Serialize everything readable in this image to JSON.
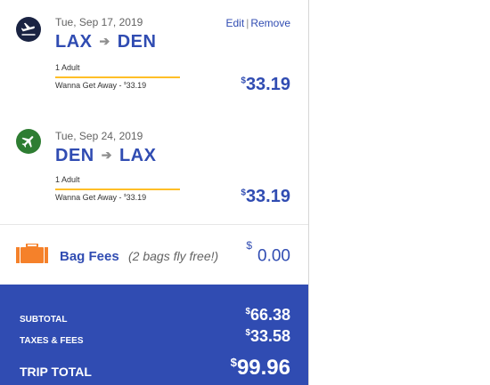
{
  "colors": {
    "brand_blue": "#304cb2",
    "dark_navy": "#1a2342",
    "green": "#2e7d32",
    "orange": "#f5812a",
    "gold": "#ffbf27"
  },
  "links": {
    "edit": "Edit",
    "separator": "|",
    "remove": "Remove"
  },
  "flights": [
    {
      "icon": "plane-takeoff-icon",
      "date": "Tue, Sep 17, 2019",
      "origin": "LAX",
      "destination": "DEN",
      "passengers": "1 Adult",
      "fare_prefix": "Wanna Get Away - ",
      "fare_currency": "$",
      "fare_amount": "33.19",
      "price_currency": "$",
      "price_amount": "33.19"
    },
    {
      "icon": "plane-landing-icon",
      "date": "Tue, Sep 24, 2019",
      "origin": "DEN",
      "destination": "LAX",
      "passengers": "1 Adult",
      "fare_prefix": "Wanna Get Away - ",
      "fare_currency": "$",
      "fare_amount": "33.19",
      "price_currency": "$",
      "price_amount": "33.19"
    }
  ],
  "bag": {
    "icon": "suitcase-icon",
    "label": "Bag Fees",
    "note": "(2 bags fly free!)",
    "currency": "$",
    "amount": "0.00"
  },
  "totals": {
    "subtotal_label": "SUBTOTAL",
    "subtotal_currency": "$",
    "subtotal_amount": "66.38",
    "taxes_label": "TAXES & FEES",
    "taxes_currency": "$",
    "taxes_amount": "33.58",
    "trip_label": "TRIP TOTAL",
    "trip_currency": "$",
    "trip_amount": "99.96"
  }
}
